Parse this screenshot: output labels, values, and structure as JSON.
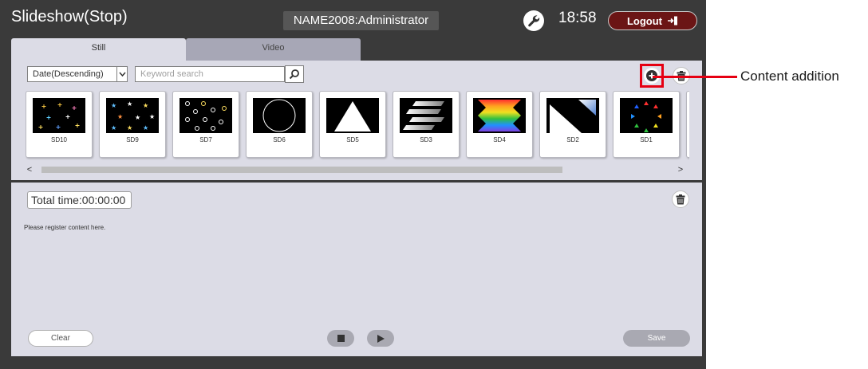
{
  "header": {
    "title": "Slideshow(Stop)",
    "user": "NAME2008:Administrator",
    "time": "18:58",
    "logout_label": "Logout",
    "settings_icon": "wrench-icon",
    "logout_icon": "logout-icon"
  },
  "tabs": [
    {
      "label": "Still",
      "active": true
    },
    {
      "label": "Video",
      "active": false
    }
  ],
  "library": {
    "sort_value": "Date(Descending)",
    "search_placeholder": "Keyword search",
    "add_icon": "add-icon",
    "delete_icon": "trash-icon",
    "thumbnails": [
      {
        "label": "SD10"
      },
      {
        "label": "SD9"
      },
      {
        "label": "SD7"
      },
      {
        "label": "SD6"
      },
      {
        "label": "SD5"
      },
      {
        "label": "SD3"
      },
      {
        "label": "SD4"
      },
      {
        "label": "SD2"
      },
      {
        "label": "SD1"
      }
    ],
    "scroll_left": "<",
    "scroll_right": ">",
    "scroll_position": 0.82
  },
  "playlist": {
    "total_time": "Total time:00:00:00",
    "hint": "Please register content here.",
    "clear_label": "Clear",
    "save_label": "Save",
    "delete_icon": "trash-icon"
  },
  "annotation": {
    "label": "Content addition",
    "color": "#e60012"
  },
  "colors": {
    "background": "#3a3a3a",
    "panel": "#dcdce6",
    "logout": "#6b1515",
    "inactive_tab": "#a7a7b6"
  }
}
